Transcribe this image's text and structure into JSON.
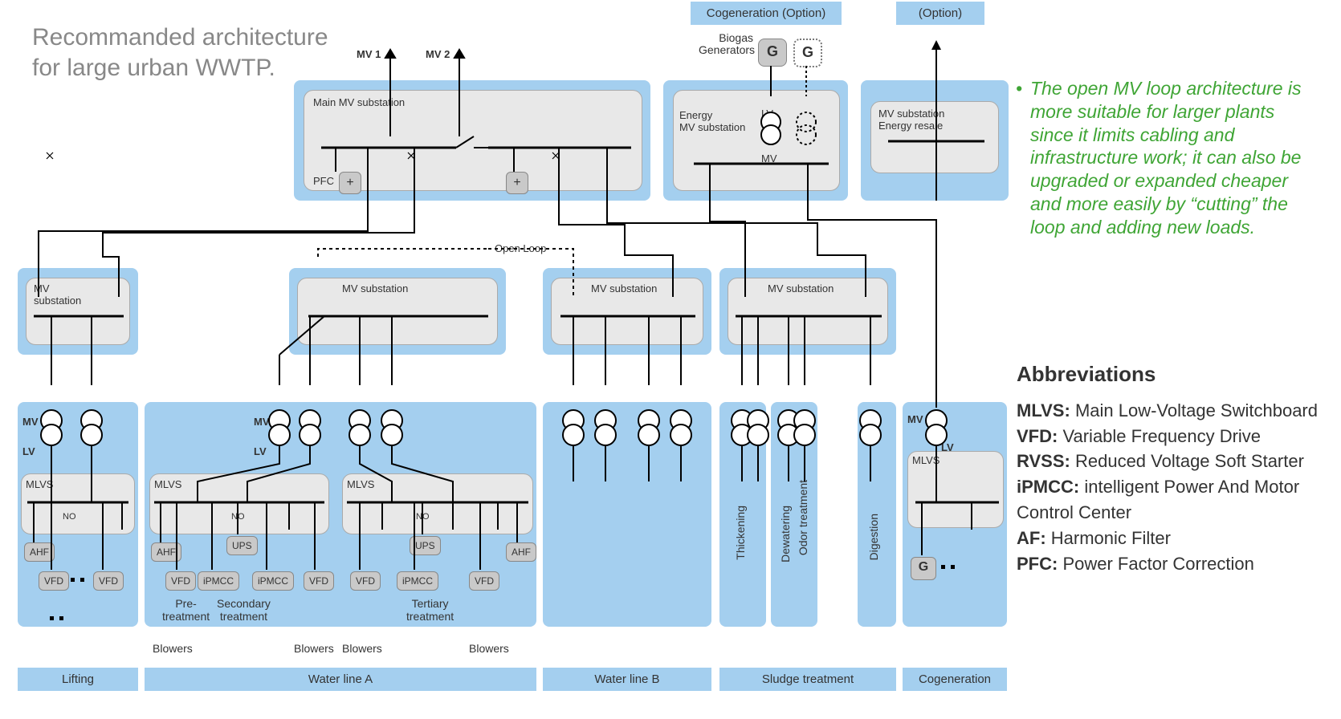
{
  "title_line1": "Recommanded architecture",
  "title_line2": "for large urban WWTP.",
  "headers": {
    "cogen_option": "Cogeneration (Option)",
    "option": "(Option)",
    "biogas": "Biogas\nGenerators"
  },
  "feeds": {
    "mv1": "MV 1",
    "mv2": "MV 2"
  },
  "boxes": {
    "main_mv": "Main MV substation",
    "energy_mv": "Energy\nMV substation",
    "mv_resale": "MV substation\nEnergy resale",
    "mv_sub": "MV substation",
    "mv_sub_small": "MV\nsubstation",
    "mlvs": "MLVS",
    "open_loop": "Open Loop"
  },
  "level_labels": {
    "mv": "MV",
    "lv": "LV"
  },
  "chips": {
    "pfc": "PFC",
    "ahf": "AHF",
    "vfd": "VFD",
    "ups": "UPS",
    "ipmcc": "iPMCC",
    "no": "NO",
    "G": "G",
    "plus": "+"
  },
  "processes": {
    "lifting": "Lifting",
    "water_a": "Water line A",
    "water_b": "Water line B",
    "sludge": "Sludge treatment",
    "cogen": "Cogeneration",
    "blowers": "Blowers",
    "pre": "Pre-\ntreatment",
    "sec": "Secondary\ntreatment",
    "ter": "Tertiary\ntreatment",
    "thick": "Thickening",
    "dewater": "Dewatering",
    "odor": "Odor treatment",
    "digest": "Digestion"
  },
  "note": "The open MV loop architecture is more suitable for larger plants since it limits cabling and infrastructure work; it can also be upgraded or expanded cheaper and more easily by “cutting” the loop and adding new loads.",
  "abbr_title": "Abbreviations",
  "abbr": {
    "MLVS": "Main Low-Voltage Switchboard",
    "VFD": "Variable Frequency Drive",
    "RVSS": "Reduced Voltage Soft Starter",
    "iPMCC": "intelligent Power And Motor Control Center",
    "AF": "Harmonic Filter",
    "PFC": "Power Factor Correction"
  }
}
